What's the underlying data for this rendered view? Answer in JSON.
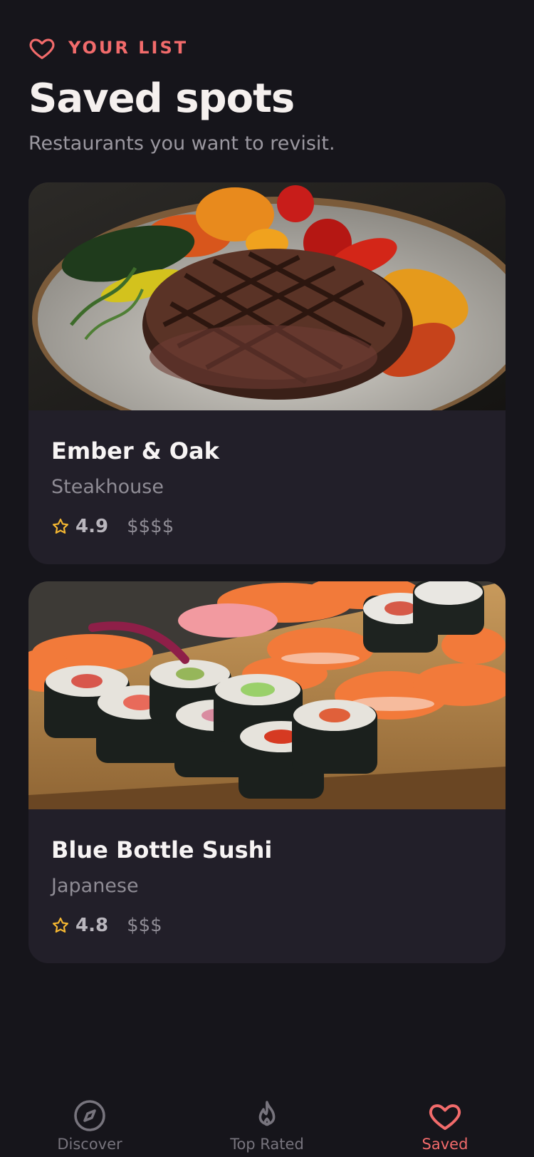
{
  "header": {
    "eyebrow": "YOUR LIST",
    "eyebrow_icon": "heart-icon",
    "title": "Saved spots",
    "subtitle": "Restaurants you want to revisit."
  },
  "cards": [
    {
      "name": "Ember & Oak",
      "cuisine": "Steakhouse",
      "rating": "4.9",
      "price": "$$$$",
      "photo": "grilled-steak-with-vegetables-photo"
    },
    {
      "name": "Blue Bottle Sushi",
      "cuisine": "Japanese",
      "rating": "4.8",
      "price": "$$$",
      "photo": "sushi-platter-photo"
    }
  ],
  "tabs": [
    {
      "label": "Discover",
      "icon": "compass-icon",
      "active": false
    },
    {
      "label": "Top Rated",
      "icon": "flame-icon",
      "active": false
    },
    {
      "label": "Saved",
      "icon": "heart-icon",
      "active": true
    }
  ],
  "colors": {
    "background": "#16151b",
    "card": "#221f29",
    "accent": "#f26b6b",
    "star": "#f5b731"
  }
}
